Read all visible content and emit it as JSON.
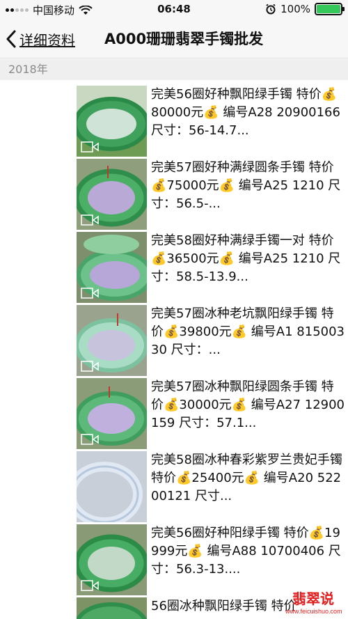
{
  "status_bar": {
    "carrier": "中国移动",
    "time": "06:48",
    "battery_percent": "100%",
    "battery_level": 1.0,
    "icons": [
      "signal-icon",
      "wifi-icon",
      "alarm-icon",
      "battery-icon"
    ]
  },
  "nav": {
    "back_label": "详细资料",
    "title": "A000珊珊翡翠手镯批发"
  },
  "year_header": "2018年",
  "feed": {
    "items": [
      {
        "text": "完美56圈好种飘阳绿手镯 特价💰80000元💰 编号A28 20900166 尺寸：56-14.7..."
      },
      {
        "text": "完美57圈好种满绿圆条手镯 特价💰75000元💰 编号A25 1210 尺寸：56.5-..."
      },
      {
        "text": "完美58圈好种满绿手镯一对 特价💰36500元💰 编号A25 1210 尺寸：58.5-13.9..."
      },
      {
        "text": "完美57圈冰种老坑飘阳绿手镯 特价💰39800元💰 编号A1 81500330 尺寸：..."
      },
      {
        "text": "完美57圈冰种飘阳绿圆条手镯 特价💰30000元💰 编号A27 12900159 尺寸：57.1..."
      },
      {
        "text": "完美58圈冰种春彩紫罗兰贵妃手镯 特价💰25400元💰 编号A20 52200121 尺寸..."
      },
      {
        "text": "完美56圈好种阳绿手镯 特价💰19999元💰 编号A88 10700406 尺寸：56.3-13...."
      },
      {
        "text": "56圈冰种飘阳绿手镯 特价"
      }
    ]
  },
  "watermark": {
    "main": "翡翠说",
    "sub": "www.feicuishuo.com"
  }
}
